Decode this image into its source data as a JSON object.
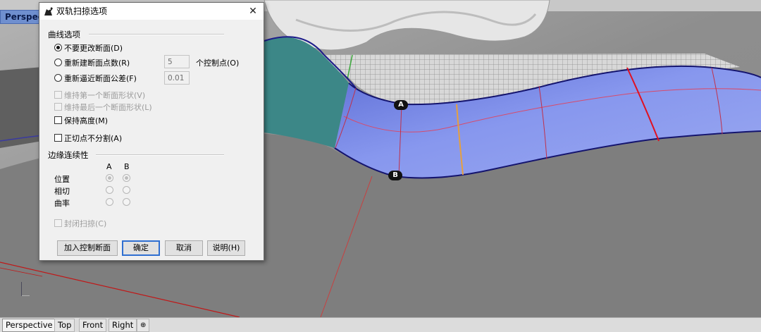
{
  "viewport": {
    "title": "Perspect",
    "point_a_label": "A",
    "point_b_label": "B"
  },
  "tabs": [
    {
      "label": "Perspective",
      "active": true
    },
    {
      "label": "Top",
      "active": false
    },
    {
      "label": "Front",
      "active": false
    },
    {
      "label": "Right",
      "active": false
    }
  ],
  "tab_add_icon": "⊕",
  "dialog": {
    "title": "双轨扫掠选项",
    "close_glyph": "✕",
    "icon": "rhino-app-icon",
    "curve_options": {
      "group_label": "曲线选项",
      "radio_no_change": "不要更改断面(D)",
      "radio_rebuild": "重新建断面点数(R)",
      "rebuild_points_value": "5",
      "rebuild_points_unit": "个控制点(O)",
      "radio_refit": "重新逼近断面公差(F)",
      "refit_tolerance_value": "0.01",
      "selected": "no_change",
      "check_keep_first": "维持第一个断面形状(V)",
      "check_keep_last": "维持最后一个断面形状(L)",
      "check_keep_height": "保持高度(M)",
      "check_no_split_tangent": "正切点不分割(A)"
    },
    "edge_continuity": {
      "group_label": "边缘连续性",
      "col_a": "A",
      "col_b": "B",
      "row_position": "位置",
      "row_tangent": "相切",
      "row_curvature": "曲率",
      "selected": "position"
    },
    "closed_sweep": "封闭扫掠(C)",
    "buttons": {
      "add_slash": "加入控制断面",
      "ok": "确定",
      "cancel": "取消",
      "help": "说明(H)"
    }
  },
  "colors": {
    "viewport_bg": "#8b8b8b",
    "surface_blue": "#7f8fe6",
    "teal_surface": "#3f8a8a",
    "dialog_bg": "#f0f0f0",
    "accent_border": "#2f6fd1"
  }
}
